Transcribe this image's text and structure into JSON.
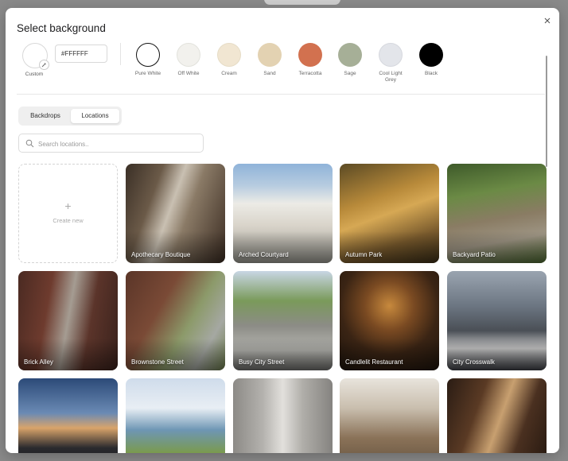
{
  "modal": {
    "title": "Select background"
  },
  "custom": {
    "label": "Custom",
    "hex_value": "#FFFFFF"
  },
  "swatches": [
    {
      "label": "Pure White",
      "color": "#FFFFFF"
    },
    {
      "label": "Off White",
      "color": "#F2F1ED"
    },
    {
      "label": "Cream",
      "color": "#F1E6D2"
    },
    {
      "label": "Sand",
      "color": "#E3D2B2"
    },
    {
      "label": "Terracotta",
      "color": "#D2714F"
    },
    {
      "label": "Sage",
      "color": "#A6AF97"
    },
    {
      "label": "Cool Light Grey",
      "color": "#E3E5EA"
    },
    {
      "label": "Black",
      "color": "#000000"
    }
  ],
  "tabs": [
    {
      "label": "Backdrops",
      "active": false
    },
    {
      "label": "Locations",
      "active": true
    }
  ],
  "search": {
    "placeholder": "Search locations.."
  },
  "create_new": {
    "label": "Create new",
    "plus": "+"
  },
  "locations": [
    {
      "label": "Apothecary Boutique"
    },
    {
      "label": "Arched Courtyard"
    },
    {
      "label": "Autumn Park"
    },
    {
      "label": "Backyard Patio"
    },
    {
      "label": "Brick Alley"
    },
    {
      "label": "Brownstone Street"
    },
    {
      "label": "Busy City Street"
    },
    {
      "label": "Candlelit Restaurant"
    },
    {
      "label": "City Crosswalk"
    },
    {
      "label": ""
    },
    {
      "label": ""
    },
    {
      "label": ""
    },
    {
      "label": ""
    },
    {
      "label": ""
    }
  ]
}
